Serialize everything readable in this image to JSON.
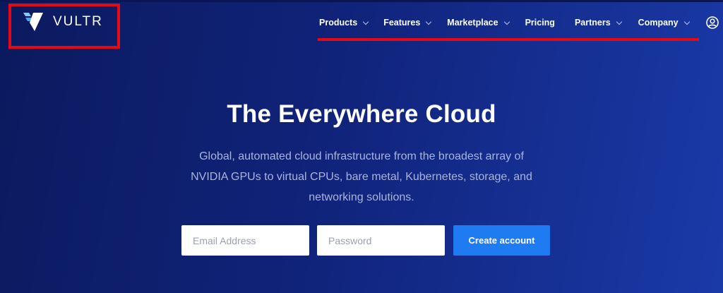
{
  "brand": {
    "name": "VULTR",
    "logo_icon": "vultr-v-icon",
    "accent_color": "#1f7bf2",
    "highlight_color": "#e50914"
  },
  "nav": {
    "items": [
      {
        "label": "Products",
        "has_dropdown": true
      },
      {
        "label": "Features",
        "has_dropdown": true
      },
      {
        "label": "Marketplace",
        "has_dropdown": true
      },
      {
        "label": "Pricing",
        "has_dropdown": false
      },
      {
        "label": "Partners",
        "has_dropdown": true
      },
      {
        "label": "Company",
        "has_dropdown": true
      }
    ],
    "account_icon": "user-circle-icon"
  },
  "hero": {
    "title": "The Everywhere Cloud",
    "subtitle": "Global, automated cloud infrastructure from the broadest array of NVIDIA GPUs to virtual CPUs, bare metal, Kubernetes, storage, and networking solutions."
  },
  "signup": {
    "email_placeholder": "Email Address",
    "password_placeholder": "Password",
    "submit_label": "Create account"
  }
}
